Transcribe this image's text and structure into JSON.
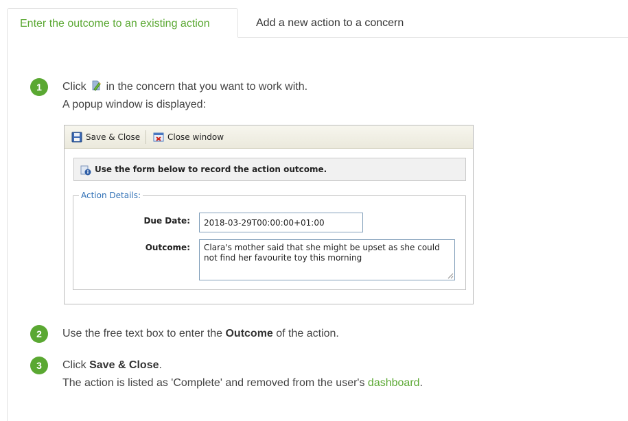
{
  "tabs": [
    {
      "label": "Enter the outcome to an existing action",
      "active": true
    },
    {
      "label": "Add a new action to a concern",
      "active": false
    }
  ],
  "steps": [
    {
      "number": "1",
      "text_before": "Click",
      "icon": "edit-pencil-icon",
      "text_after": " in the concern that you want to work with.",
      "sub": "A popup window is displayed:"
    },
    {
      "number": "2",
      "text_before": "Use the free text box to enter the ",
      "bold": "Outcome",
      "text_after": " of the action."
    },
    {
      "number": "3",
      "text_before": "Click ",
      "bold": "Save & Close",
      "text_after": ".",
      "sub_before": "The action is listed as 'Complete' and removed from the user's ",
      "sub_link": "dashboard",
      "sub_after": "."
    }
  ],
  "popup": {
    "toolbar": {
      "save_label": "Save & Close",
      "close_label": "Close window"
    },
    "info_text": "Use the form below to record the action outcome.",
    "fieldset_legend": "Action Details:",
    "due_date_label": "Due Date:",
    "due_date_value": "2018-03-29T00:00:00+01:00",
    "outcome_label": "Outcome:",
    "outcome_value": "Clara's mother said that she might be upset as she could not find her favourite toy this morning"
  },
  "colors": {
    "accent": "#5aa832",
    "legend": "#2e6fb5"
  }
}
